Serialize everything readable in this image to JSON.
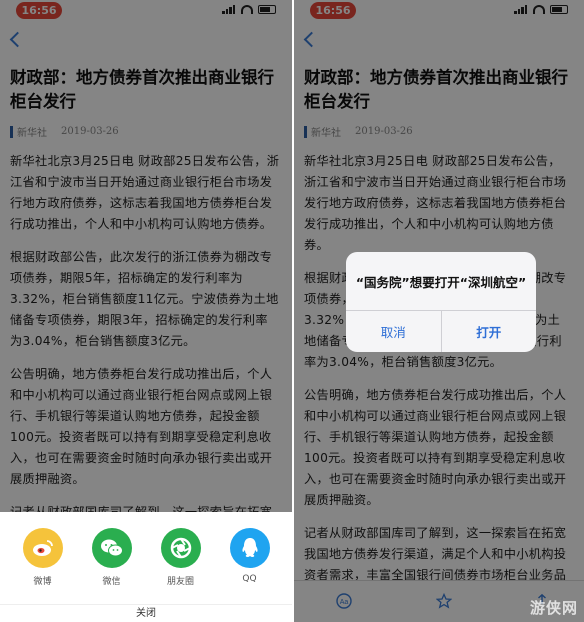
{
  "status": {
    "time": "16:56",
    "pill_color": "#e8473b"
  },
  "article": {
    "title": "财政部：地方债券首次推出商业银行柜台发行",
    "source": "新华社",
    "date": "2019-03-26",
    "paragraphs": [
      "新华社北京3月25日电 财政部25日发布公告，浙江省和宁波市当日开始通过商业银行柜台市场发行地方政府债券，这标志着我国地方债券柜台发行成功推出，个人和中小机构可认购地方债券。",
      "根据财政部公告，此次发行的浙江债券为棚改专项债券，期限5年，招标确定的发行利率为3.32%，柜台销售额度11亿元。宁波债券为土地储备专项债券，期限3年，招标确定的发行利率为3.04%，柜台销售额度3亿元。",
      "公告明确，地方债券柜台发行成功推出后，个人和中小机构可以通过商业银行柜台网点或网上银行、手机银行等渠道认购地方债券，起投金额100元。投资者既可以持有到期享受稳定利息收入，也可在需要资金时随时向承办银行卖出或开展质押融资。",
      "记者从财政部国库司了解到，这一探索旨在拓宽我国地方债券发行渠道，满足个人和中小机构投资者需求，丰富全国银行间债券市场柜台业务品种。"
    ]
  },
  "share_sheet": {
    "items": [
      {
        "label": "微博",
        "icon": "weibo-icon",
        "color": "#f5c33b"
      },
      {
        "label": "微信",
        "icon": "wechat-icon",
        "color": "#2aae4f"
      },
      {
        "label": "朋友圈",
        "icon": "moments-icon",
        "color": "#2aae4f"
      },
      {
        "label": "QQ",
        "icon": "qq-icon",
        "color": "#1fa4f0"
      }
    ],
    "close_label": "关闭"
  },
  "alert": {
    "message": "“国务院”想要打开“深圳航空”",
    "cancel_label": "取消",
    "open_label": "打开"
  },
  "watermark": "游侠网"
}
